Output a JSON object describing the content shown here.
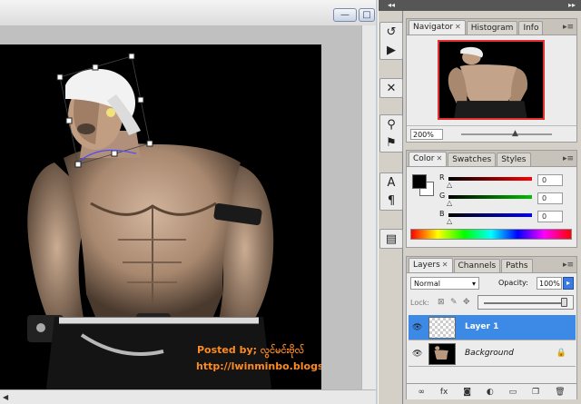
{
  "document": {
    "window_buttons": [
      "—",
      "□"
    ],
    "watermark_posted": "Posted by; လွင်မင်းဗိုလ်",
    "watermark_url": "http://lwinminbo.blogspot.com/"
  },
  "toolbar": {
    "collapse_glyph": "◂◂",
    "groups": [
      {
        "tools": [
          {
            "name": "history-brush-icon",
            "glyph": "↺"
          },
          {
            "name": "actions-play-icon",
            "glyph": "▶"
          }
        ]
      },
      {
        "tools": [
          {
            "name": "tool-presets-icon",
            "glyph": "✕"
          }
        ]
      },
      {
        "tools": [
          {
            "name": "brushes-icon",
            "glyph": "⚲"
          },
          {
            "name": "clone-source-icon",
            "glyph": "⚑"
          }
        ]
      },
      {
        "tools": [
          {
            "name": "character-icon",
            "glyph": "A"
          },
          {
            "name": "paragraph-icon",
            "glyph": "¶"
          }
        ]
      },
      {
        "tools": [
          {
            "name": "layer-comps-icon",
            "glyph": "▤"
          }
        ]
      }
    ]
  },
  "panels": {
    "collapse_glyph": "▸▸",
    "navigator": {
      "tabs": [
        {
          "label": "Navigator",
          "active": true
        },
        {
          "label": "Histogram",
          "active": false
        },
        {
          "label": "Info",
          "active": false
        }
      ],
      "zoom": "200%"
    },
    "color": {
      "tabs": [
        {
          "label": "Color",
          "active": true
        },
        {
          "label": "Swatches",
          "active": false
        },
        {
          "label": "Styles",
          "active": false
        }
      ],
      "channels": [
        {
          "label": "R",
          "value": "0",
          "gradient": "#ff0000"
        },
        {
          "label": "G",
          "value": "0",
          "gradient": "#00c000"
        },
        {
          "label": "B",
          "value": "0",
          "gradient": "#0000ff"
        }
      ],
      "foreground": "#000000",
      "background": "#ffffff"
    },
    "layers": {
      "tabs": [
        {
          "label": "Layers",
          "active": true
        },
        {
          "label": "Channels",
          "active": false
        },
        {
          "label": "Paths",
          "active": false
        }
      ],
      "blend_mode": "Normal",
      "opacity_label": "Opacity:",
      "opacity_value": "100%",
      "lock_label": "Lock:",
      "items": [
        {
          "name": "Layer 1",
          "selected": true
        },
        {
          "name": "Background",
          "selected": false
        }
      ]
    }
  }
}
